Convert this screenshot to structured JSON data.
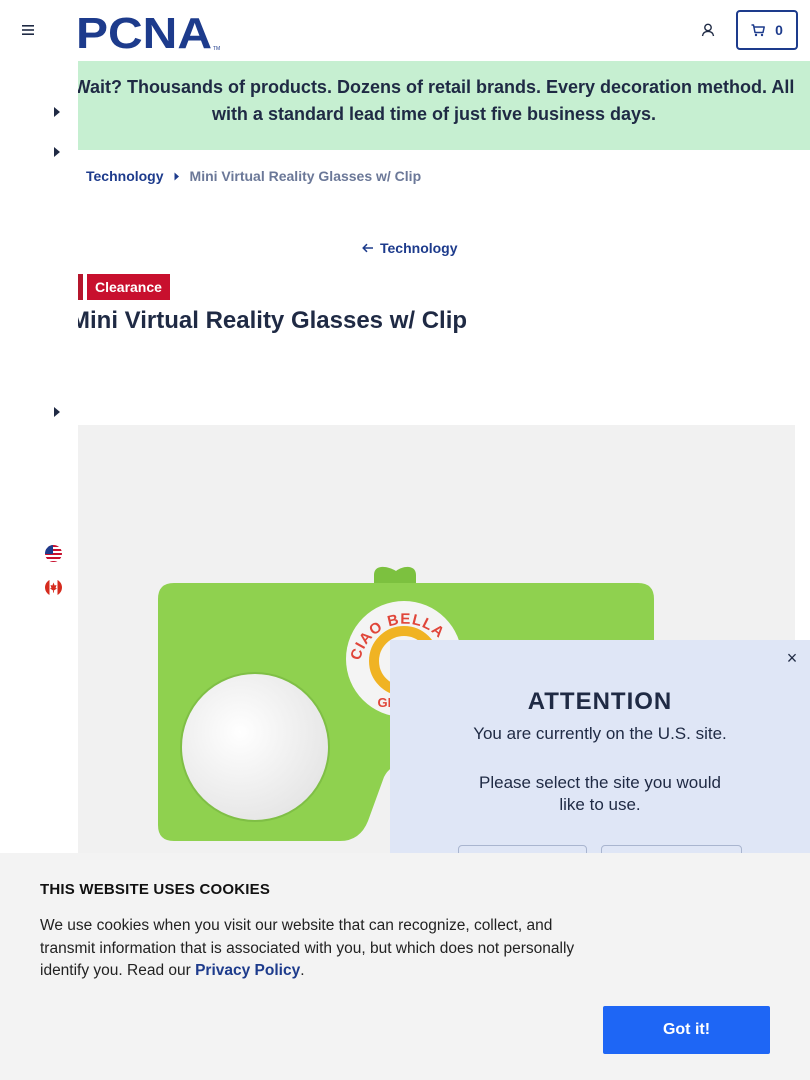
{
  "header": {
    "logo_text": "PCNA",
    "logo_tm": "TM",
    "cart_count": "0"
  },
  "promo": {
    "text": "Wait? Thousands of products. Dozens of retail brands. Every decoration method. All with a standard lead time of just five business days."
  },
  "breadcrumb": {
    "items": [
      "Technology",
      "Mini Virtual Reality Glasses w/ Clip"
    ]
  },
  "back_link": {
    "label": "Technology"
  },
  "product": {
    "badge": "Clearance",
    "title": "Mini Virtual Reality Glasses w/ Clip",
    "image_color": "#8fd14f",
    "logo_text_top": "CIAO BELLA",
    "logo_text_bottom": "GELATO"
  },
  "modal": {
    "close_label": "×",
    "title": "ATTENTION",
    "line1": "You are currently on the U.S. site.",
    "line2": "Please select the site you would like to use."
  },
  "cookie": {
    "title": "THIS WEBSITE USES COOKIES",
    "body": "We use cookies when you visit our website that can recognize, collect, and transmit information that is associated with you, but which does not personally identify you. Read our ",
    "link": "Privacy Policy",
    "period": ".",
    "button": "Got it!"
  },
  "colors": {
    "brand_blue": "#1d3b8c",
    "promo_green": "#c6efd1",
    "clearance_red": "#c8102e",
    "cookie_button": "#1e66f5",
    "modal_bg": "#dfe6f6"
  }
}
